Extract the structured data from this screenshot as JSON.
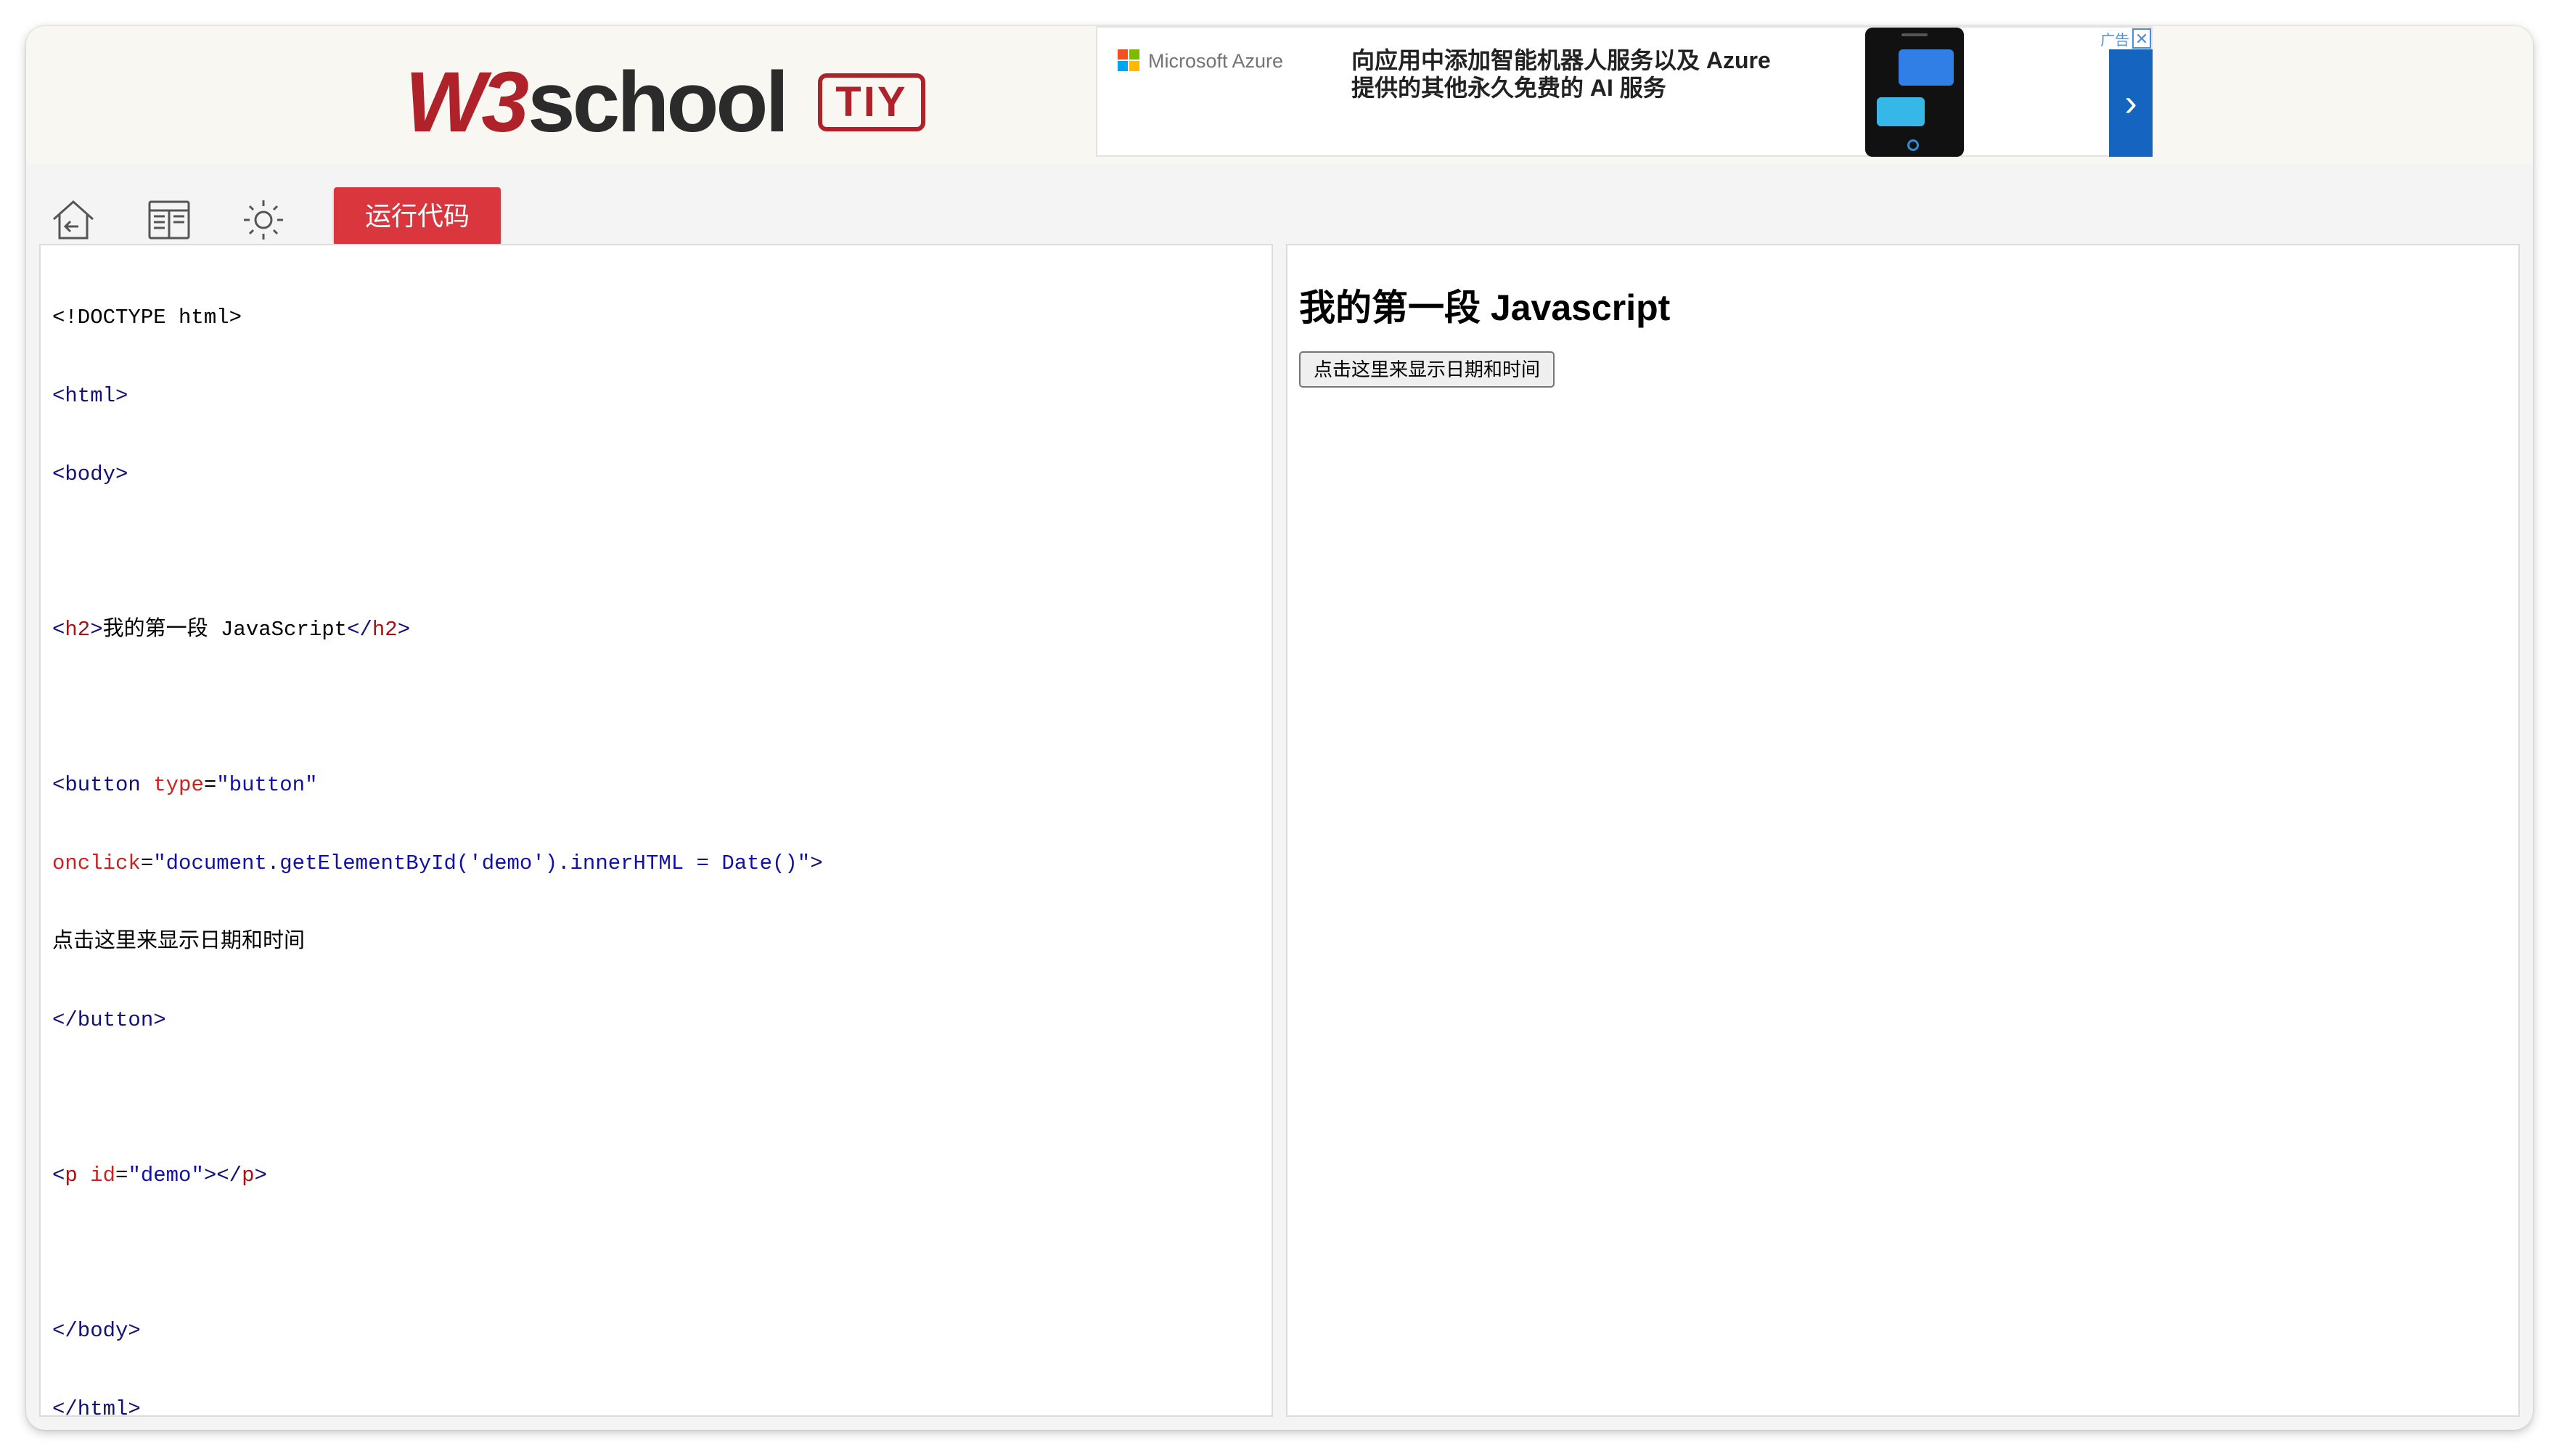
{
  "header": {
    "logo_w3": "W3",
    "logo_school": "school",
    "logo_badge": "TIY"
  },
  "ad": {
    "brand": "Microsoft Azure",
    "line1": "向应用中添加智能机器人服务以及 Azure",
    "line2": "提供的其他永久免费的 AI 服务",
    "label": "广告",
    "close": "✕",
    "next": "›"
  },
  "toolbar": {
    "icons": [
      "home-back-icon",
      "layout-icon",
      "theme-sun-icon"
    ],
    "run_label": "运行代码"
  },
  "editor": {
    "lines": {
      "doctype": "<!DOCTYPE html>",
      "html_open": "<html>",
      "body_open": "<body>",
      "h2_text": "我的第一段 JavaScript",
      "btn_type_value": "\"button\"",
      "onclick_value": "\"document.getElementById('demo').innerHTML = Date()\"",
      "btn_text": "点击这里来显示日期和时间",
      "p_id_value": "\"demo\"",
      "body_close": "</body>",
      "html_close": "</html>"
    }
  },
  "result": {
    "heading": "我的第一段 Javascript",
    "button_label": "点击这里来显示日期和时间"
  },
  "colors": {
    "accent_red": "#d9363e",
    "logo_red": "#b02229",
    "ad_blue": "#1565c0"
  }
}
